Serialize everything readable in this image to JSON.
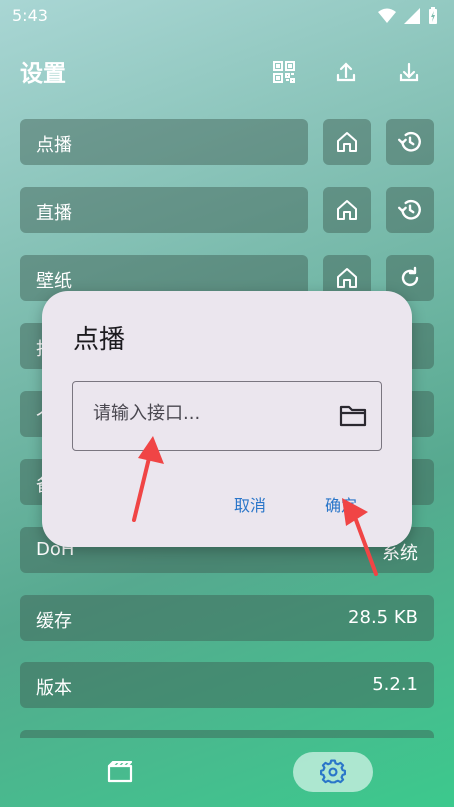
{
  "statusbar": {
    "time": "5:43"
  },
  "header": {
    "title": "设置"
  },
  "rows": [
    {
      "label": "点播",
      "value": ""
    },
    {
      "label": "直播",
      "value": ""
    },
    {
      "label": "壁纸",
      "value": ""
    },
    {
      "label": "抖",
      "value": ""
    },
    {
      "label": "个",
      "value": ""
    },
    {
      "label": "备",
      "value": ""
    },
    {
      "label": "DoH",
      "value": "系统"
    },
    {
      "label": "缓存",
      "value": "28.5 KB"
    },
    {
      "label": "版本",
      "value": "5.2.1"
    }
  ],
  "dialog": {
    "title": "点播",
    "input_placeholder": "请输入接口...",
    "cancel_label": "取消",
    "confirm_label": "确定"
  },
  "colors": {
    "accent": "#2a76c9",
    "dialog_bg": "#ebe6ee",
    "annotation_arrow": "#f04545"
  },
  "icons": [
    "wifi-icon",
    "signal-icon",
    "battery-icon",
    "qr-code-icon",
    "upload-icon",
    "download-icon",
    "home-icon",
    "history-icon",
    "refresh-icon",
    "folder-icon",
    "film-icon",
    "gear-icon"
  ]
}
